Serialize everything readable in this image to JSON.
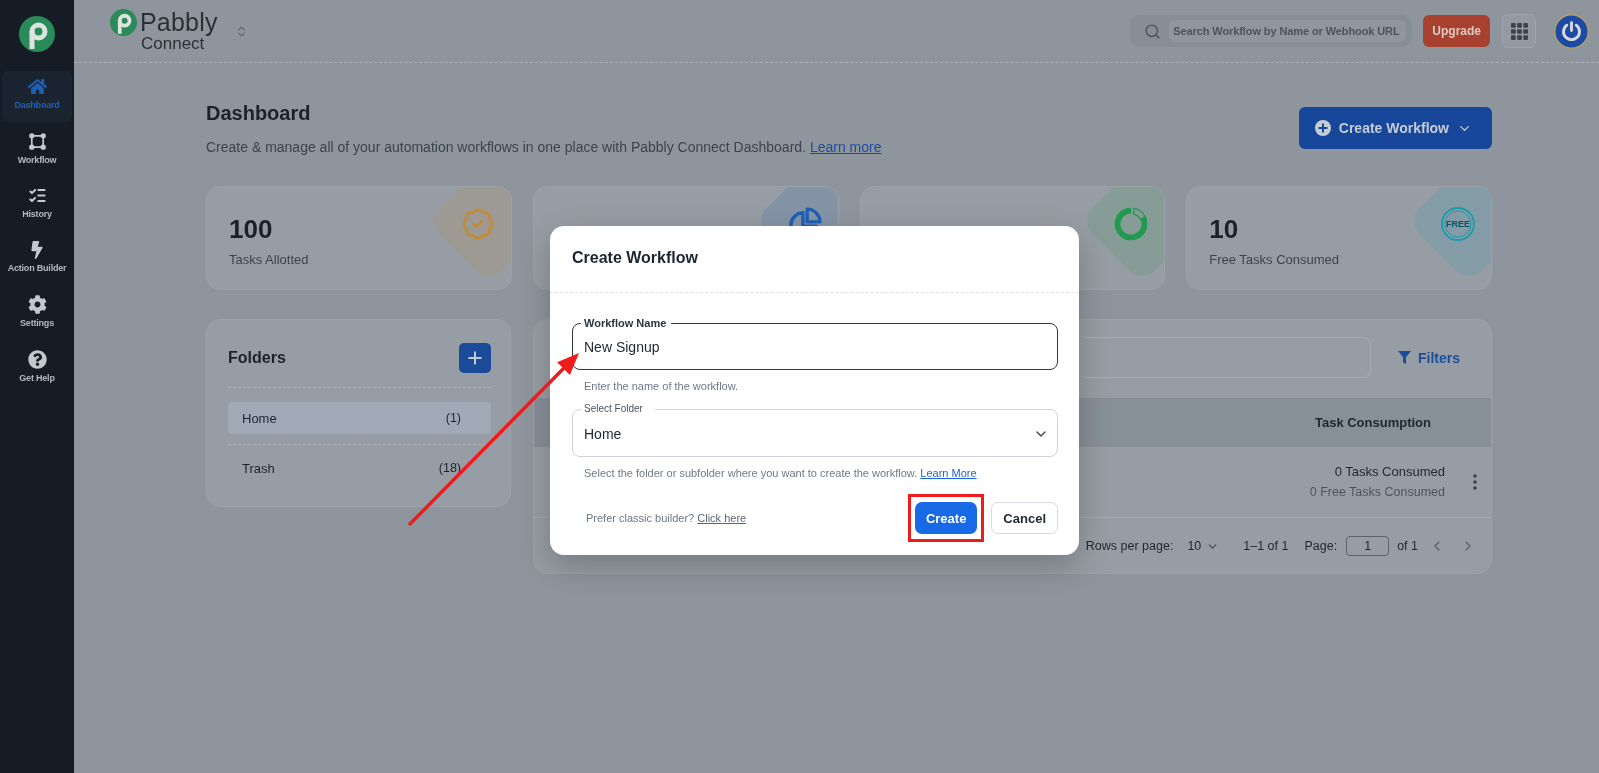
{
  "sidebar": {
    "items": [
      {
        "label": "Dashboard",
        "selected": true
      },
      {
        "label": "Workflow",
        "selected": false
      },
      {
        "label": "History",
        "selected": false
      },
      {
        "label": "Action Builder",
        "selected": false
      },
      {
        "label": "Settings",
        "selected": false
      },
      {
        "label": "Get Help",
        "selected": false
      }
    ]
  },
  "header": {
    "logo": {
      "name": "Pabbly",
      "product": "Connect"
    },
    "search": {
      "placeholder": "Search Workflow by Name or Webhook URL"
    },
    "upgrade_button": "Upgrade"
  },
  "page": {
    "title": "Dashboard",
    "subtitle": {
      "text": "Create & manage all of your automation workflows in one place with Pabbly Connect Dashboard.",
      "link": "Learn more"
    },
    "create_button": "Create Workflow"
  },
  "stats": [
    {
      "color": "#c38b34",
      "value": "100",
      "label": "Tasks Allotted"
    },
    {
      "color": "#1f5fb6"
    },
    {
      "color": "#1f9a4f"
    },
    {
      "color": "#1a9bb0",
      "value": "10",
      "label": "Free Tasks Consumed",
      "stamp": "FREE"
    }
  ],
  "folders": {
    "title": "Folders",
    "items": [
      {
        "name": "Home",
        "count": "(1)",
        "selected": true
      },
      {
        "name": "Trash",
        "count": "(18)",
        "selected": false
      }
    ]
  },
  "table": {
    "filters_button": "Filters",
    "columns": [
      "Task Consumption"
    ],
    "rows": [
      {
        "tasks": "0 Tasks Consumed",
        "free_tasks": "0 Free Tasks Consumed"
      }
    ],
    "pagination": {
      "rows_per_page_label": "Rows per page:",
      "rows_per_page": "10",
      "range": "1–1 of 1",
      "page_label": "Page:",
      "page": "1",
      "page_total": "of 1"
    }
  },
  "dialog": {
    "title": "Create Workflow",
    "name_field": {
      "label": "Workflow Name",
      "value": "New Signup",
      "focused": true,
      "pointed": true
    },
    "name_hint": "Enter the name of the workflow.",
    "folder_field": {
      "label": "Select Folder",
      "value": "Home",
      "focused": false
    },
    "folder_hint": {
      "text": "Select the folder or subfolder where you want to create the workflow.",
      "link": "Learn More"
    },
    "classic_prompt": {
      "text": "Prefer classic builder?",
      "link": "Click here"
    },
    "buttons": [
      {
        "label": "Create",
        "kind": "primary",
        "highlighted": true
      },
      {
        "label": "Cancel",
        "kind": "secondary",
        "highlighted": false
      }
    ]
  }
}
